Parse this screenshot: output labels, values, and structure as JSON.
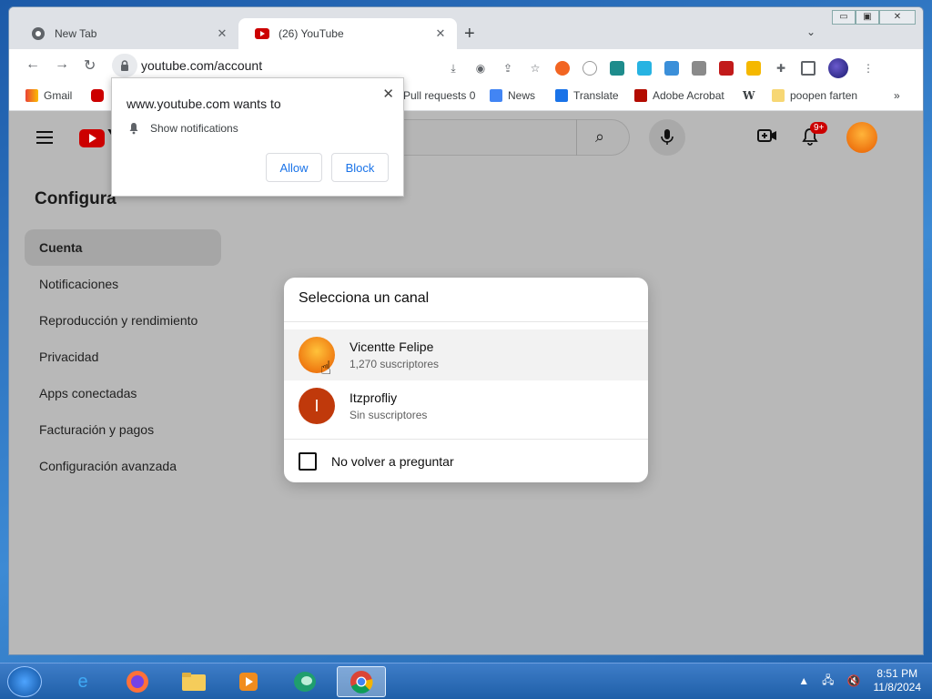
{
  "browser": {
    "tabs": [
      {
        "title": "New Tab",
        "close": "✕"
      },
      {
        "title": "(26) YouTube",
        "close": "✕"
      }
    ],
    "new_tab": "+",
    "tab_menu": "⌄",
    "window_controls": {
      "minimize": "▭",
      "maximize": "▣",
      "close": "✕"
    },
    "address": "youtube.com/account",
    "bookmarks": [
      {
        "label": "Gmail"
      },
      {
        "label": "Pull requests 0"
      },
      {
        "label": "News"
      },
      {
        "label": "Translate"
      },
      {
        "label": "Adobe Acrobat"
      },
      {
        "label": "W"
      },
      {
        "label": "poopen farten"
      }
    ],
    "bookmarks_more": "»"
  },
  "permission_popup": {
    "title": "www.youtube.com wants to",
    "item": "Show notifications",
    "allow": "Allow",
    "block": "Block",
    "close": "✕"
  },
  "youtube": {
    "logo_partial": "Y",
    "notification_count": "9+",
    "settings_title": "Configura",
    "nav": [
      {
        "label": "Cuenta",
        "active": true
      },
      {
        "label": "Notificaciones"
      },
      {
        "label": "Reproducción y rendimiento"
      },
      {
        "label": "Privacidad"
      },
      {
        "label": "Apps conectadas"
      },
      {
        "label": "Facturación y pagos"
      },
      {
        "label": "Configuración avanzada"
      }
    ]
  },
  "dialog": {
    "title": "Selecciona un canal",
    "channels": [
      {
        "name": "Vicentte Felipe",
        "subs": "1,270 suscriptores"
      },
      {
        "name": "Itzprofliy",
        "subs": "Sin suscriptores",
        "initial": "I"
      }
    ],
    "checkbox_label": "No volver a preguntar"
  },
  "taskbar": {
    "time": "8:51 PM",
    "date": "11/8/2024"
  },
  "colors": {
    "youtube_red": "#cc0000",
    "link_blue": "#1a73e8",
    "channel2_avatar": "#c0390b"
  }
}
